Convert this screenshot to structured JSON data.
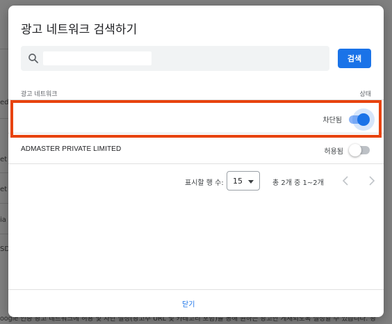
{
  "background": {
    "rows": [
      "ed",
      "et",
      "et",
      "ia",
      "SD"
    ],
    "footer_text": "oogle 인증 광고 네트워크에 허용 및 차단 설정(광고주 URL 및 카테고리 포함)을 통해 원하는 광고만 게재되도록 설정할 수 있습니다. 광"
  },
  "dialog": {
    "title": "광고 네트워크 검색하기",
    "search": {
      "value": "",
      "button_label": "검색",
      "icon": "search-icon"
    },
    "table": {
      "headers": {
        "network": "광고 네트워크",
        "status": "상태"
      },
      "rows": [
        {
          "name": "",
          "status": "차단됨",
          "enabled": true
        },
        {
          "name": "ADMASTER PRIVATE LIMITED",
          "status": "허용됨",
          "enabled": false
        }
      ]
    },
    "pagination": {
      "rows_label": "표시할 행 수:",
      "rows_per_page": "15",
      "range": "총 2개 중 1~2개"
    },
    "close_label": "닫기"
  },
  "colors": {
    "accent": "#1a73e8",
    "highlight": "#e8430e"
  }
}
